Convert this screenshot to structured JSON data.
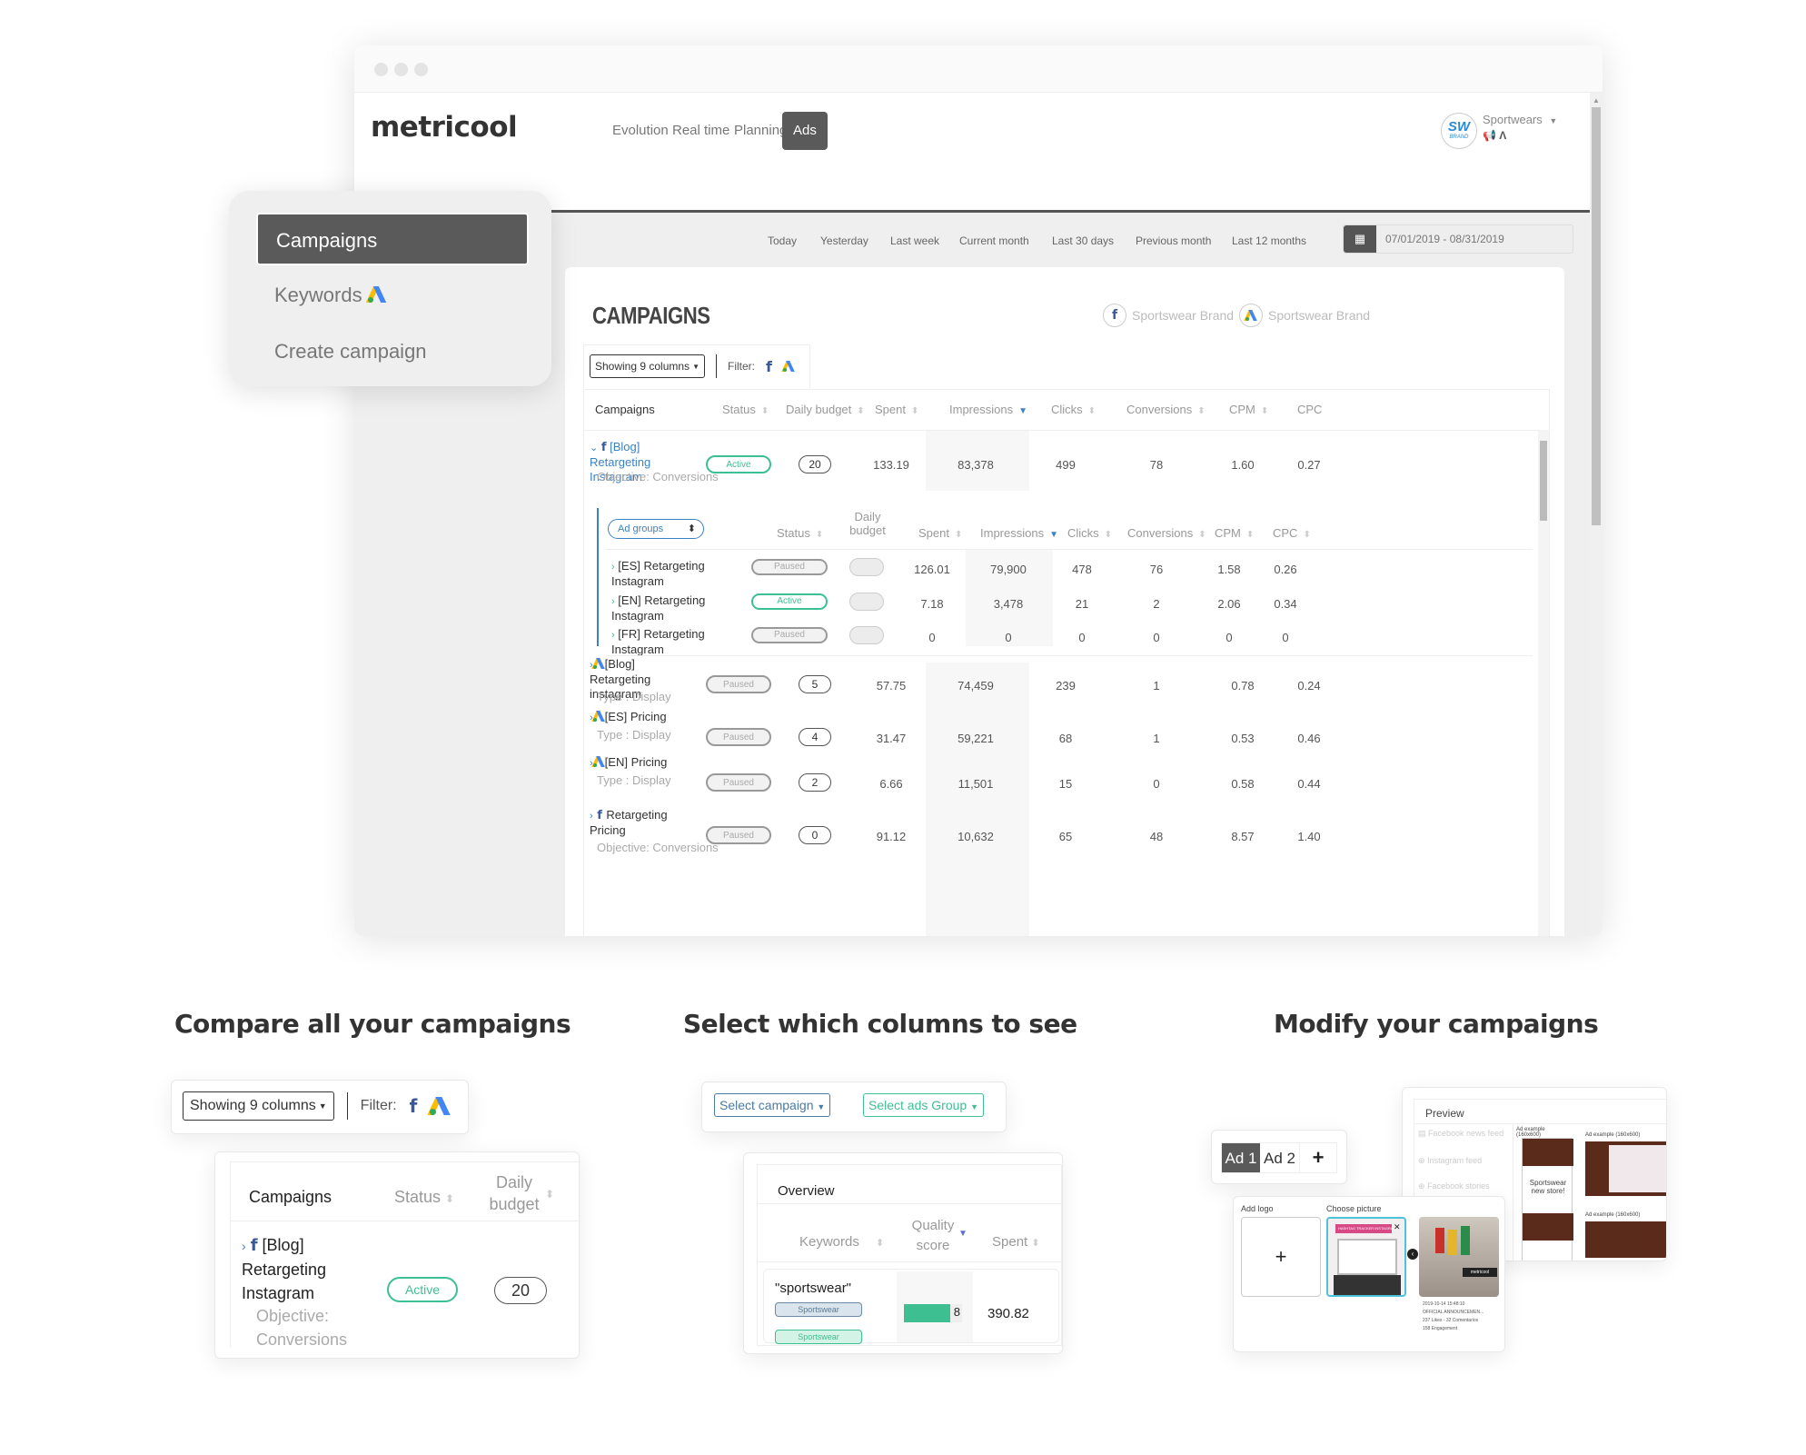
{
  "app": {
    "logo": "metricool",
    "nav": [
      "Evolution",
      "Real time",
      "Planning",
      "Ads"
    ],
    "nav_active": "Ads",
    "brand": {
      "initials": "SW",
      "sub": "BRAND",
      "name": "Sportwears"
    },
    "date_ranges": [
      "Today",
      "Yesterday",
      "Last week",
      "Current month",
      "Last 30 days",
      "Previous month",
      "Last 12 months"
    ],
    "date_value": "07/01/2019 - 08/31/2019"
  },
  "menu": {
    "items": [
      "Campaigns",
      "Keywords",
      "Create campaign"
    ],
    "active": "Campaigns"
  },
  "panel": {
    "title": "CAMPAIGNS",
    "accounts": [
      {
        "network": "facebook",
        "label": "Sportswear Brand"
      },
      {
        "network": "google-ads",
        "label": "Sportswear Brand"
      }
    ],
    "columns_button": "Showing 9 columns",
    "filter_label": "Filter:",
    "headers": [
      "Campaigns",
      "Status",
      "Daily budget",
      "Spent",
      "Impressions",
      "Clicks",
      "Conversions",
      "CPM",
      "CPC"
    ],
    "sorted_column": "Impressions",
    "campaigns": [
      {
        "network": "facebook",
        "expanded": true,
        "name": "[Blog] Retargeting Instagram",
        "meta": "Objective: Conversions",
        "status": "Active",
        "budget": "20",
        "spent": "133.19",
        "impressions": "83,378",
        "clicks": "499",
        "conversions": "78",
        "cpm": "1.60",
        "cpc": "0.27"
      },
      {
        "network": "google-ads",
        "expanded": false,
        "name": "[Blog] Retargeting instagram",
        "meta": "Type : Display",
        "status": "Paused",
        "budget": "5",
        "spent": "57.75",
        "impressions": "74,459",
        "clicks": "239",
        "conversions": "1",
        "cpm": "0.78",
        "cpc": "0.24"
      },
      {
        "network": "google-ads",
        "expanded": false,
        "name": "[ES] Pricing",
        "meta": "Type : Display",
        "status": "Paused",
        "budget": "4",
        "spent": "31.47",
        "impressions": "59,221",
        "clicks": "68",
        "conversions": "1",
        "cpm": "0.53",
        "cpc": "0.46"
      },
      {
        "network": "google-ads",
        "expanded": false,
        "name": "[EN] Pricing",
        "meta": "Type : Display",
        "status": "Paused",
        "budget": "2",
        "spent": "6.66",
        "impressions": "11,501",
        "clicks": "15",
        "conversions": "0",
        "cpm": "0.58",
        "cpc": "0.44"
      },
      {
        "network": "facebook",
        "expanded": false,
        "name": "Retargeting Pricing",
        "meta": "Objective: Conversions",
        "status": "Paused",
        "budget": "0",
        "spent": "91.12",
        "impressions": "10,632",
        "clicks": "65",
        "conversions": "48",
        "cpm": "8.57",
        "cpc": "1.40"
      }
    ],
    "adgroups": {
      "selector": "Ad groups",
      "headers": [
        "Status",
        "Daily budget",
        "Spent",
        "Impressions",
        "Clicks",
        "Conversions",
        "CPM",
        "CPC"
      ],
      "rows": [
        {
          "name": "[ES] Retargeting Instagram",
          "status": "Paused",
          "spent": "126.01",
          "impressions": "79,900",
          "clicks": "478",
          "conversions": "76",
          "cpm": "1.58",
          "cpc": "0.26"
        },
        {
          "name": "[EN] Retargeting Instagram",
          "status": "Active",
          "spent": "7.18",
          "impressions": "3,478",
          "clicks": "21",
          "conversions": "2",
          "cpm": "2.06",
          "cpc": "0.34"
        },
        {
          "name": "[FR] Retargeting Instagram",
          "status": "Paused",
          "spent": "0",
          "impressions": "0",
          "clicks": "0",
          "conversions": "0",
          "cpm": "0",
          "cpc": "0"
        }
      ]
    }
  },
  "features": [
    {
      "title": "Compare all your campaigns",
      "columns_button": "Showing 9 columns",
      "filter_label": "Filter:",
      "headers": [
        "Campaigns",
        "Status",
        "Daily budget"
      ],
      "row": {
        "name": "[Blog] Retargeting Instagram",
        "meta": "Objective: Conversions",
        "status": "Active",
        "budget": "20"
      }
    },
    {
      "title": "Select which columns to see",
      "select_campaign": "Select campaign",
      "select_group": "Select ads Group",
      "overview": "Overview",
      "headers": [
        "Keywords",
        "Quality score",
        "Spent"
      ],
      "row": {
        "keyword": "\"sportswear\"",
        "tags": [
          "Sportswear",
          "Sportswear"
        ],
        "quality_score": 8,
        "quality_max": 10,
        "spent": "390.82"
      }
    },
    {
      "title": "Modify your campaigns",
      "ad_tabs": [
        "Ad 1",
        "Ad 2",
        "+"
      ],
      "active_tab": "Ad 1",
      "preview_title": "Preview",
      "placements": [
        "Facebook news feed",
        "Instagram feed",
        "Facebook stories"
      ],
      "ad_examples": [
        "Ad example (160x600)",
        "Ad example (160x600)",
        "Ad example (160x600)"
      ],
      "ad_text": "Sportswear new store!",
      "add_logo": "Add logo",
      "choose_picture": "Choose picture",
      "picture_banner": "HASHTAG TRACKER INSTAGRAM",
      "picture_badge": "metricool",
      "post_meta": [
        "2019-10-14 15:48:10",
        "OFFICIAL ANNOUNCEMEN...",
        "237 Likes - 32 Comentarios",
        "158 Engagement"
      ]
    }
  ]
}
